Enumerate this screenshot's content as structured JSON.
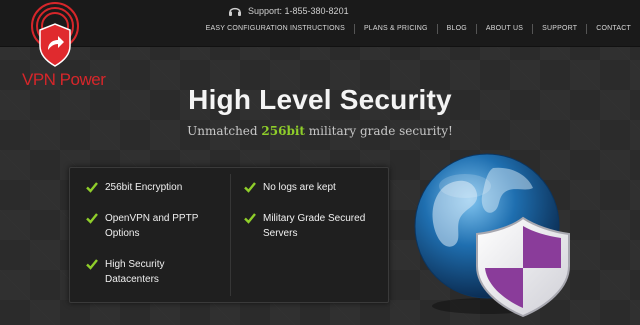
{
  "header": {
    "support_text": "Support: 1-855-380-8201",
    "nav": [
      "EASY CONFIGURATION INSTRUCTIONS",
      "PLANS & PRICING",
      "BLOG",
      "ABOUT US",
      "SUPPORT",
      "CONTACT"
    ]
  },
  "logo": {
    "text": "VPN Power"
  },
  "hero": {
    "title": "High Level Security",
    "subtitle_pre": "Unmatched ",
    "subtitle_highlight": "256bit",
    "subtitle_post": " military grade security!"
  },
  "features": [
    {
      "lines": [
        "256bit Encryption"
      ]
    },
    {
      "lines": [
        "No logs are kept"
      ]
    },
    {
      "lines": [
        "OpenVPN and PPTP",
        "Options"
      ]
    },
    {
      "lines": [
        "Military Grade Secured",
        "Servers"
      ]
    },
    {
      "lines": [
        "High Security",
        "Datacenters"
      ]
    }
  ],
  "colors": {
    "accent_green": "#8fce2a",
    "brand_red": "#d6262a",
    "shield_purple": "#8a3c9a"
  },
  "icons": {
    "support": "headset-icon",
    "check": "check-icon",
    "globe": "globe-icon",
    "shield": "shield-icon"
  }
}
